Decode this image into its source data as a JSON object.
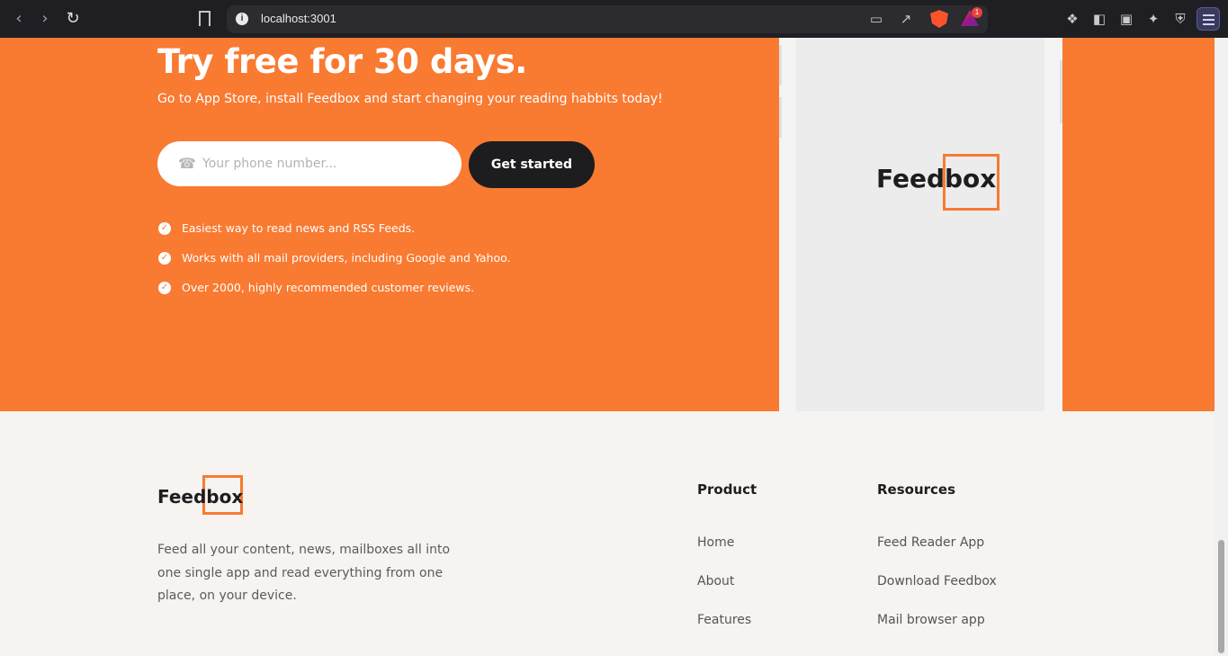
{
  "browser": {
    "url": "localhost:3001"
  },
  "hero": {
    "title": "Try free for 30 days.",
    "subtitle": "Go to App Store, install Feedbox and start changing your reading habbits today!",
    "phone_placeholder": "Your phone number...",
    "cta_label": "Get started",
    "features": [
      "Easiest way to read news and RSS Feeds.",
      "Works with all mail providers, including Google and Yahoo.",
      "Over 2000, highly recommended customer reviews."
    ],
    "device_logo": "Feedbox"
  },
  "footer": {
    "logo": "Feedbox",
    "description": "Feed all your content, news, mailboxes all into one single app and read everything from one place, on your device.",
    "columns": [
      {
        "title": "Product",
        "links": [
          "Home",
          "About",
          "Features"
        ]
      },
      {
        "title": "Resources",
        "links": [
          "Feed Reader App",
          "Download Feedbox",
          "Mail browser app"
        ]
      }
    ]
  },
  "colors": {
    "brand_orange": "#f97a31",
    "dark": "#1d1d1f",
    "footer_bg": "#f6f3f0"
  },
  "icons": [
    "back-icon",
    "forward-icon",
    "reload-icon",
    "bookmark-icon",
    "info-icon",
    "cast-icon",
    "share-icon",
    "brave-shield-icon",
    "rewards-icon",
    "extensions-icon",
    "sidebar-icon",
    "wallet-icon",
    "leo-icon",
    "vpn-icon",
    "menu-icon",
    "phone-icon",
    "check-icon"
  ]
}
